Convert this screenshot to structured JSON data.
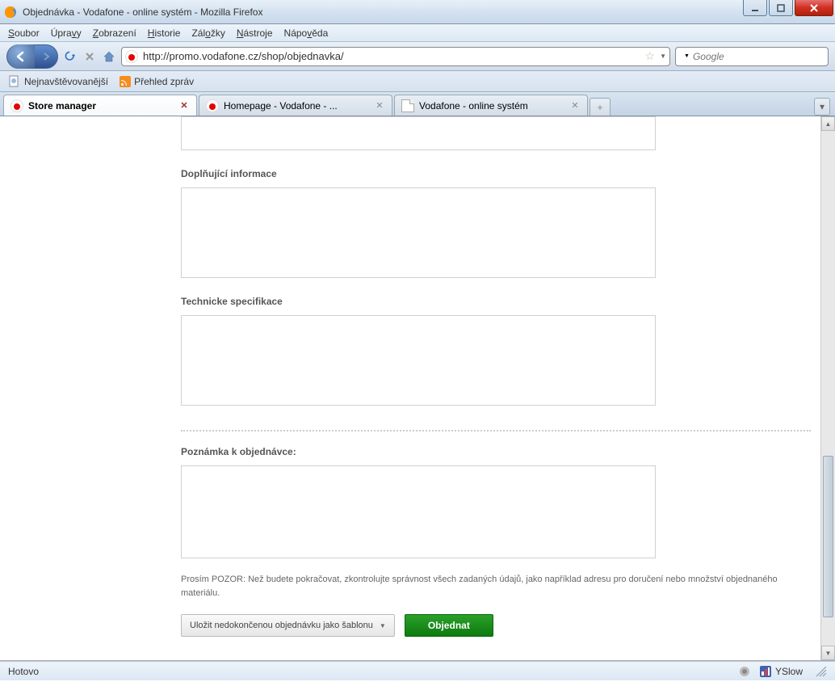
{
  "window": {
    "title": "Objednávka - Vodafone - online systém - Mozilla Firefox"
  },
  "menubar": {
    "items": [
      "Soubor",
      "Úpravy",
      "Zobrazení",
      "Historie",
      "Záložky",
      "Nástroje",
      "Nápověda"
    ],
    "underline_idx": [
      0,
      4,
      0,
      0,
      2,
      0,
      4
    ]
  },
  "navbar": {
    "url": "http://promo.vodafone.cz/shop/objednavka/",
    "search_placeholder": "Google"
  },
  "bookmarks": {
    "items": [
      {
        "label": "Nejnavštěvovanější",
        "icon": "page"
      },
      {
        "label": "Přehled zpráv",
        "icon": "rss"
      }
    ]
  },
  "tabs": {
    "items": [
      {
        "label": "Store manager",
        "icon": "vodafone",
        "active": true
      },
      {
        "label": "Homepage - Vodafone - ...",
        "icon": "vodafone",
        "active": false
      },
      {
        "label": "Vodafone - online systém",
        "icon": "page",
        "active": false
      }
    ]
  },
  "form": {
    "sections": {
      "info": "Doplňující informace",
      "spec": "Technicke specifikace",
      "note": "Poznámka k objednávce:"
    },
    "warning": "Prosím POZOR: Než budete pokračovat, zkontrolujte správnost všech zadaných údajů, jako například adresu pro doručení nebo množství objednaného materiálu.",
    "template_btn": "Uložit nedokončenou objednávku jako šablonu",
    "order_btn": "Objednat"
  },
  "statusbar": {
    "left": "Hotovo",
    "yslow": "YSlow"
  }
}
